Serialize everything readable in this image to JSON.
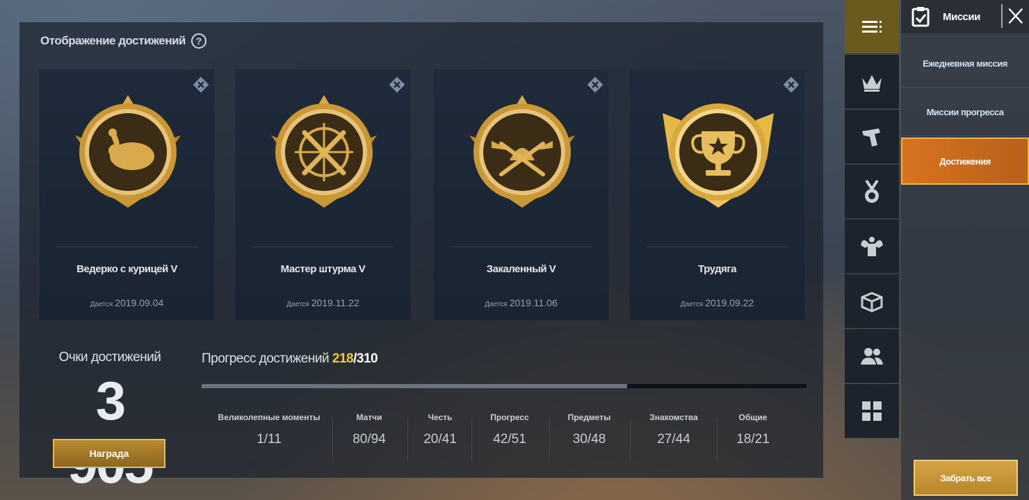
{
  "achievement_display": {
    "title": "Отображение достижений",
    "help_icon": "help-circle-icon",
    "cards": [
      {
        "name": "Ведерко с курицей V",
        "date_label": "Дается",
        "date": "2019.09.04",
        "badge_icon": "chicken-badge-icon"
      },
      {
        "name": "Мастер штурма V",
        "date_label": "Дается",
        "date": "2019.11.22",
        "badge_icon": "crosshair-rifles-badge-icon"
      },
      {
        "name": "Закаленный V",
        "date_label": "Дается",
        "date": "2019.11.06",
        "badge_icon": "winged-helmet-badge-icon"
      },
      {
        "name": "Трудяга",
        "date_label": "Дается",
        "date": "2019.09.22",
        "badge_icon": "trophy-badge-icon"
      }
    ]
  },
  "points": {
    "label": "Очки достижений",
    "value": "3 905",
    "reward_button": "Награда"
  },
  "progress": {
    "label": "Прогресс достижений",
    "current": "218",
    "total": "/310",
    "fraction": 0.703,
    "categories": [
      {
        "label": "Великолепные моменты",
        "value": "1/11"
      },
      {
        "label": "Матчи",
        "value": "80/94"
      },
      {
        "label": "Честь",
        "value": "20/41"
      },
      {
        "label": "Прогресс",
        "value": "42/51"
      },
      {
        "label": "Предметы",
        "value": "30/48"
      },
      {
        "label": "Знакомства",
        "value": "27/44"
      },
      {
        "label": "Общие",
        "value": "18/21"
      }
    ]
  },
  "sidebar_icons": [
    "menu-icon",
    "crown-icon",
    "pistol-icon",
    "medal-icon",
    "muscle-icon",
    "crate-icon",
    "friends-icon",
    "grid-icon"
  ],
  "missions": {
    "title": "Миссии",
    "tabs": [
      "Ежедневная миссия",
      "Миссии прогресса",
      "Достижения"
    ],
    "active_tab": "Достижения",
    "claim_all": "Забрать все"
  },
  "colors": {
    "gold": "#d7a94a",
    "accent_orange": "#d7731d",
    "progress_highlight": "#f2cc2e"
  }
}
